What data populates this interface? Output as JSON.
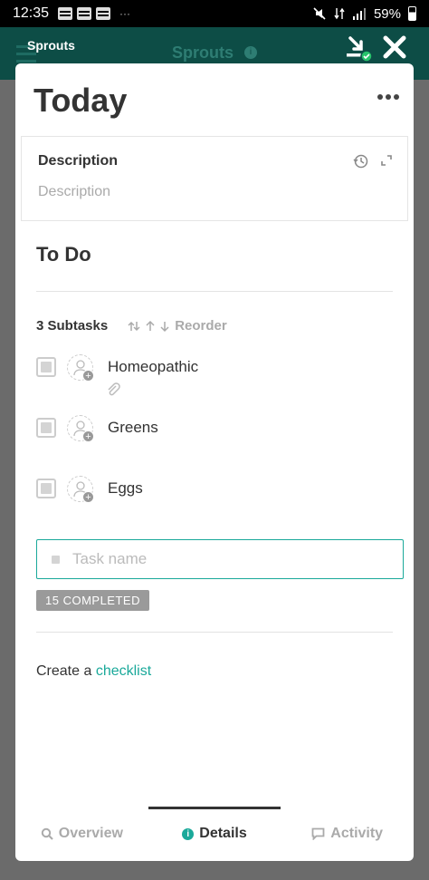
{
  "status_bar": {
    "time": "12:35",
    "overflow": "···",
    "battery": "59%"
  },
  "app_bar": {
    "app_name": "Sprouts",
    "faded_title": "Sprouts"
  },
  "card": {
    "title": "Today",
    "description": {
      "label": "Description",
      "placeholder": "Description"
    },
    "section_title": "To Do",
    "subtasks": {
      "count_label": "3 Subtasks",
      "reorder_label": "Reorder",
      "items": [
        {
          "name": "Homeopathic",
          "has_attachment": true
        },
        {
          "name": "Greens",
          "has_attachment": false
        },
        {
          "name": "Eggs",
          "has_attachment": false
        }
      ]
    },
    "new_task": {
      "placeholder": "Task name"
    },
    "completed_badge": "15 COMPLETED",
    "checklist": {
      "prefix": "Create a",
      "link": "checklist"
    }
  },
  "tabs": [
    {
      "label": "Overview",
      "active": false
    },
    {
      "label": "Details",
      "active": true
    },
    {
      "label": "Activity",
      "active": false
    }
  ],
  "colors": {
    "accent": "#1aa99a",
    "app_bar": "#0d4d46"
  }
}
